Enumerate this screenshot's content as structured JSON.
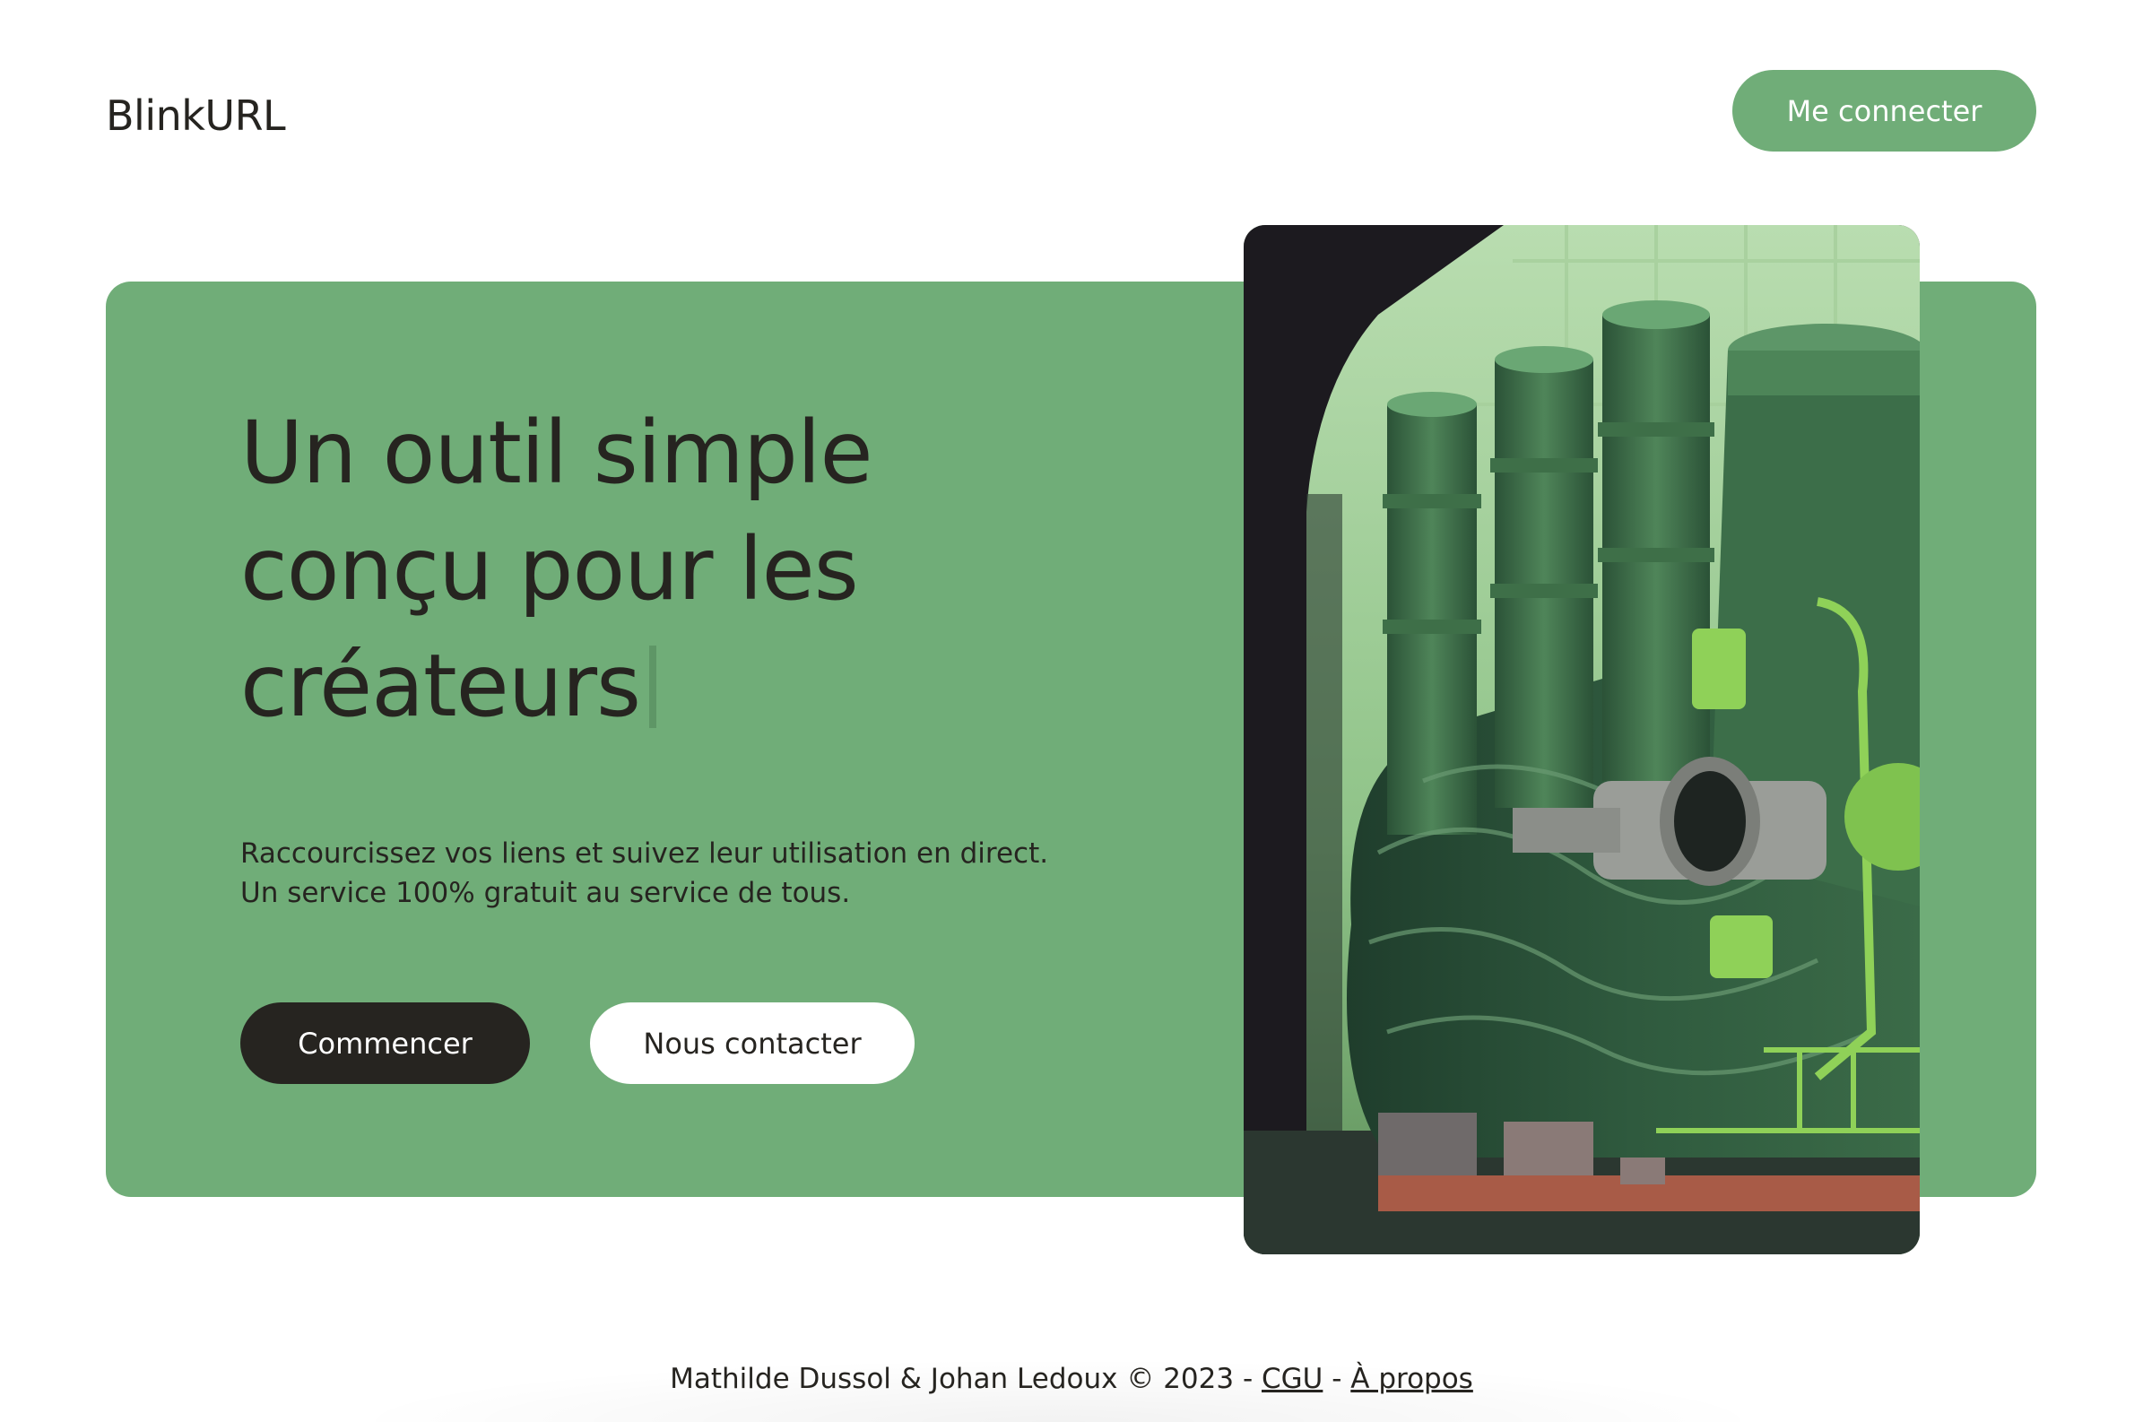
{
  "header": {
    "logo": "BlinkURL",
    "login_label": "Me connecter"
  },
  "hero": {
    "headline_lines": [
      "Un outil simple",
      "conçu pour les",
      "créateurs"
    ],
    "subtitle_lines": [
      "Raccourcissez vos liens et suivez leur utilisation en direct.",
      "Un service 100% gratuit au service de tous."
    ],
    "start_label": "Commencer",
    "contact_label": "Nous contacter",
    "illustration_icon": "industrial-machine-illustration"
  },
  "footer": {
    "credits": "Mathilde Dussol & Johan Ledoux © 2023 -",
    "separator": "-",
    "cgu_label": "CGU",
    "about_label": "À propos"
  },
  "colors": {
    "accent_green": "#70ad78",
    "dark": "#262420",
    "background": "#ffffff"
  }
}
